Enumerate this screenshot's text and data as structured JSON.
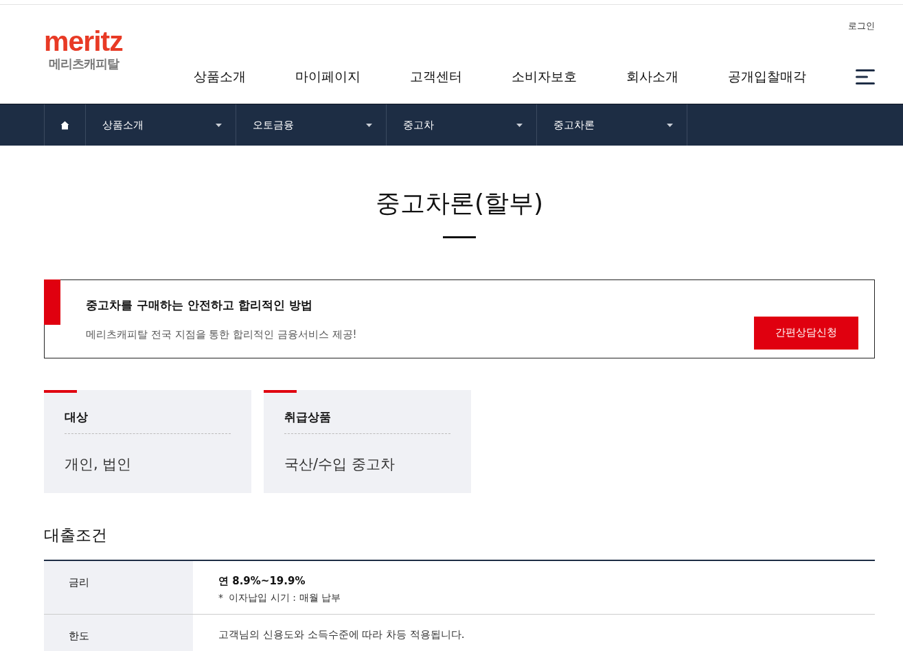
{
  "logo": {
    "wordmark": "meritz",
    "subtitle": "메리츠캐피탈"
  },
  "top_links": [
    "로그인"
  ],
  "main_nav": [
    "상품소개",
    "마이페이지",
    "고객센터",
    "소비자보호",
    "회사소개",
    "공개입찰매각"
  ],
  "breadcrumb": [
    "상품소개",
    "오토금융",
    "중고차",
    "중고차론"
  ],
  "page_title": "중고차론(할부)",
  "banner": {
    "heading": "중고차를 구매하는 안전하고 합리적인 방법",
    "text": "메리츠캐피탈 전국 지점을 통한 합리적인 금융서비스 제공!",
    "button": "간편상담신청"
  },
  "info_cards": [
    {
      "label": "대상",
      "value": "개인, 법인"
    },
    {
      "label": "취급상품",
      "value": "국산/수입 중고차"
    }
  ],
  "conditions": {
    "title": "대출조건",
    "rows": [
      {
        "label": "금리",
        "value": "연 8.9%~19.9%",
        "note": "이자납입 시기 : 매월 납부",
        "note_mark": "*"
      },
      {
        "label": "한도",
        "value": "고객님의 신용도와 소득수준에 따라 차등 적용됩니다."
      }
    ]
  }
}
